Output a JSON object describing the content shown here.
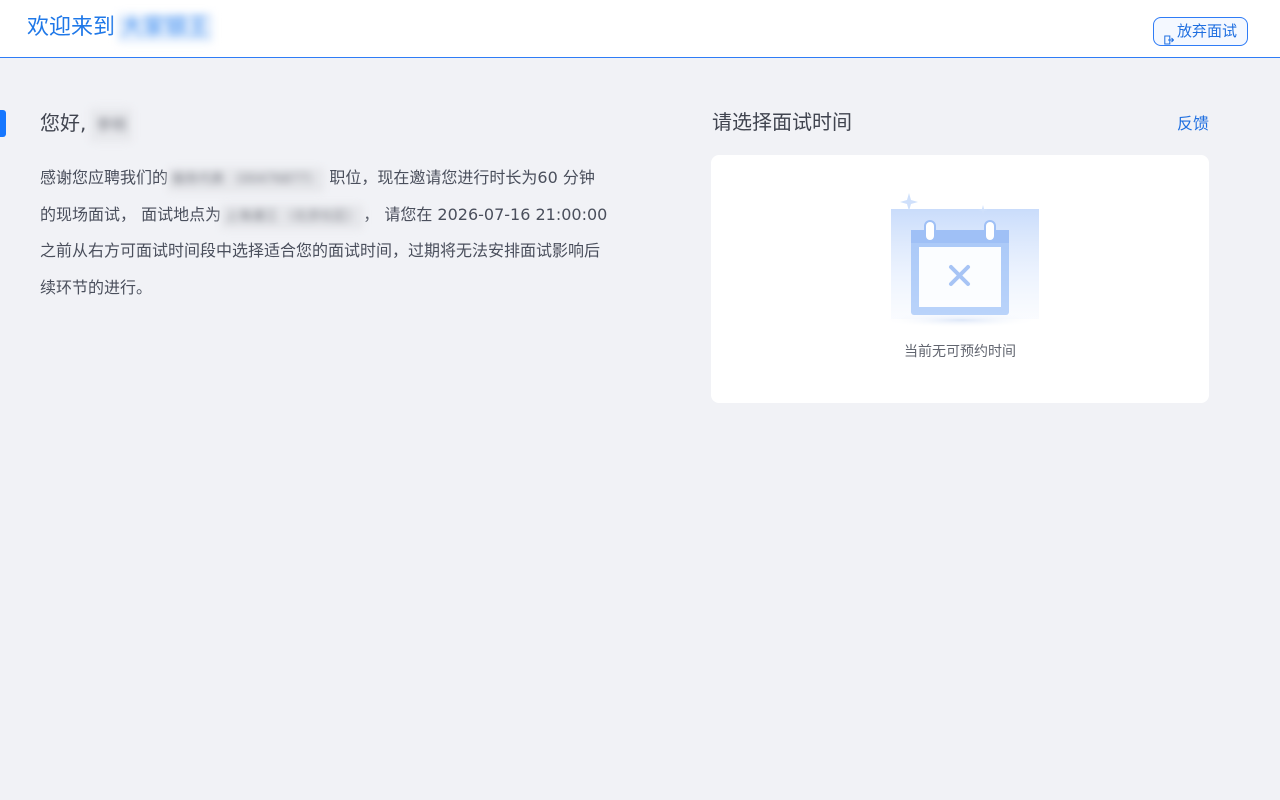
{
  "header": {
    "welcome_prefix": "欢迎来到",
    "company_name": "大家银王",
    "quit_button_label": "放弃面试",
    "quit_icon": "logout-icon"
  },
  "left": {
    "greeting_prefix": "您好,",
    "candidate_name": "李明",
    "desc_1": "感谢您应聘我们的",
    "position_name": "服务代表 （00476877）",
    "desc_2": " 职位，现在邀请您进行时长为60 分钟的现场面试， 面试地点为",
    "location": "上海浦江 （北京社区）",
    "desc_3": "， 请您在 2026-07-16 21:00:00 之前从右方可面试时间段中选择适合您的面试时间，过期将无法安排面试影响后续环节的进行。"
  },
  "right": {
    "title": "请选择面试时间",
    "feedback_label": "反馈",
    "empty_text": "当前无可预约时间",
    "empty_icon": "calendar-unavailable-icon"
  },
  "colors": {
    "accent": "#1f6fe0",
    "background": "#f1f2f6",
    "card": "#ffffff"
  }
}
